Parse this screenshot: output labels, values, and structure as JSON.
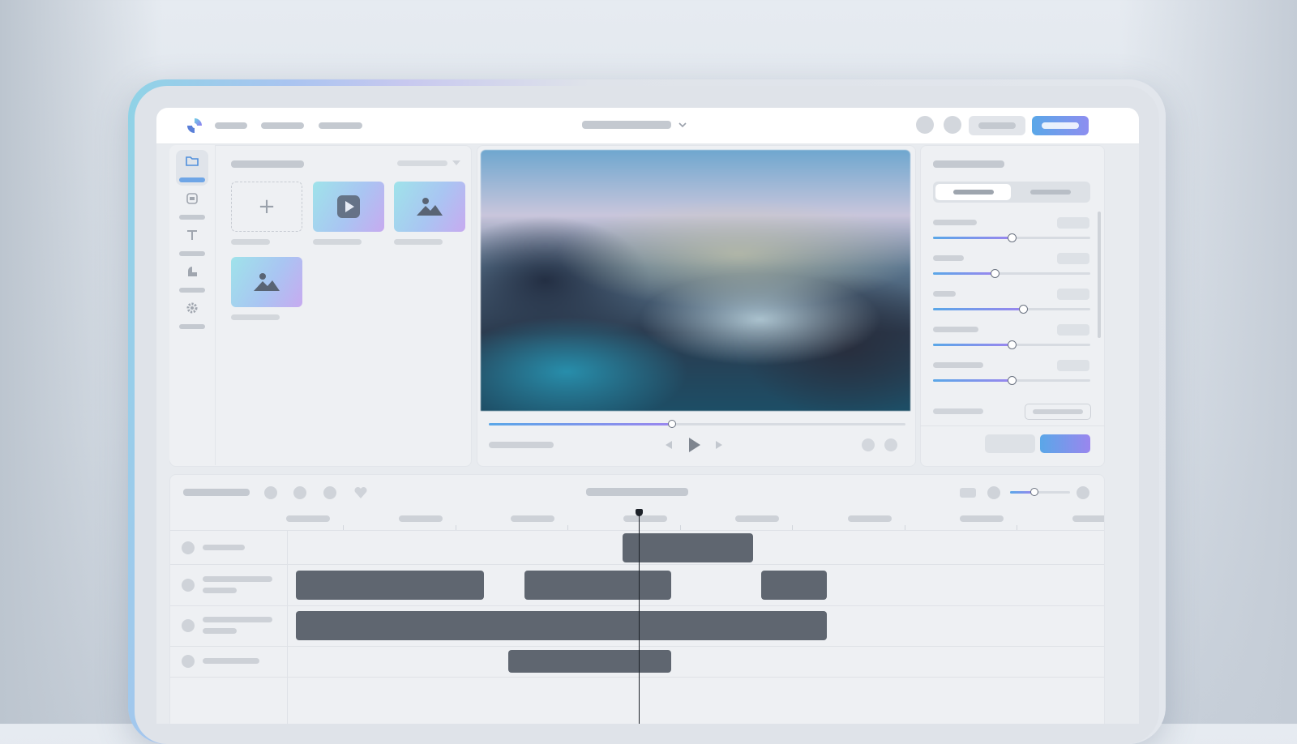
{
  "app": {
    "nav_items": [
      "",
      "",
      ""
    ],
    "project_title": "",
    "header_buttons": {
      "secondary": "",
      "primary": ""
    }
  },
  "tools": [
    {
      "icon": "folder-icon",
      "label": "",
      "active": true
    },
    {
      "icon": "template-icon",
      "label": "",
      "active": false
    },
    {
      "icon": "text-icon",
      "label": "",
      "active": false
    },
    {
      "icon": "shapes-icon",
      "label": "",
      "active": false
    },
    {
      "icon": "gear-icon",
      "label": "",
      "active": false
    }
  ],
  "media_panel": {
    "title": "",
    "filter_label": "",
    "items": [
      {
        "type": "add",
        "icon": "plus-icon",
        "caption": ""
      },
      {
        "type": "video",
        "icon": "play-icon",
        "caption": ""
      },
      {
        "type": "image",
        "icon": "image-icon",
        "caption": ""
      },
      {
        "type": "image",
        "icon": "image-icon",
        "caption": ""
      }
    ]
  },
  "preview": {
    "progress": 0.44,
    "timecode": "",
    "controls": [
      "prev-icon",
      "play-icon",
      "next-icon"
    ]
  },
  "properties": {
    "title": "",
    "tabs": [
      {
        "label": "",
        "active": true
      },
      {
        "label": "",
        "active": false
      }
    ],
    "sliders": [
      {
        "label": "",
        "value": 0.5
      },
      {
        "label": "",
        "value": 0.39
      },
      {
        "label": "",
        "value": 0.57
      },
      {
        "label": "",
        "value": 0.5
      },
      {
        "label": "",
        "value": 0.5
      }
    ],
    "footer_label": "",
    "footer_select": "",
    "actions": {
      "cancel": "",
      "apply": ""
    }
  },
  "timeline": {
    "title": "",
    "center_label": "",
    "zoom": 0.4,
    "tracks": [
      {
        "name": "",
        "clips": [
          [
            0.41,
            0.57
          ]
        ]
      },
      {
        "name": "",
        "clips": [
          [
            0.01,
            0.24
          ],
          [
            0.29,
            0.47
          ],
          [
            0.58,
            0.66
          ]
        ]
      },
      {
        "name": "",
        "clips": [
          [
            0.01,
            0.66
          ]
        ]
      },
      {
        "name": "",
        "clips": [
          [
            0.27,
            0.47
          ]
        ]
      }
    ],
    "playhead": 0.43
  },
  "colors": {
    "accent_start": "#5aa7e8",
    "accent_end": "#8d8ef0",
    "clip": "#5f6670"
  }
}
